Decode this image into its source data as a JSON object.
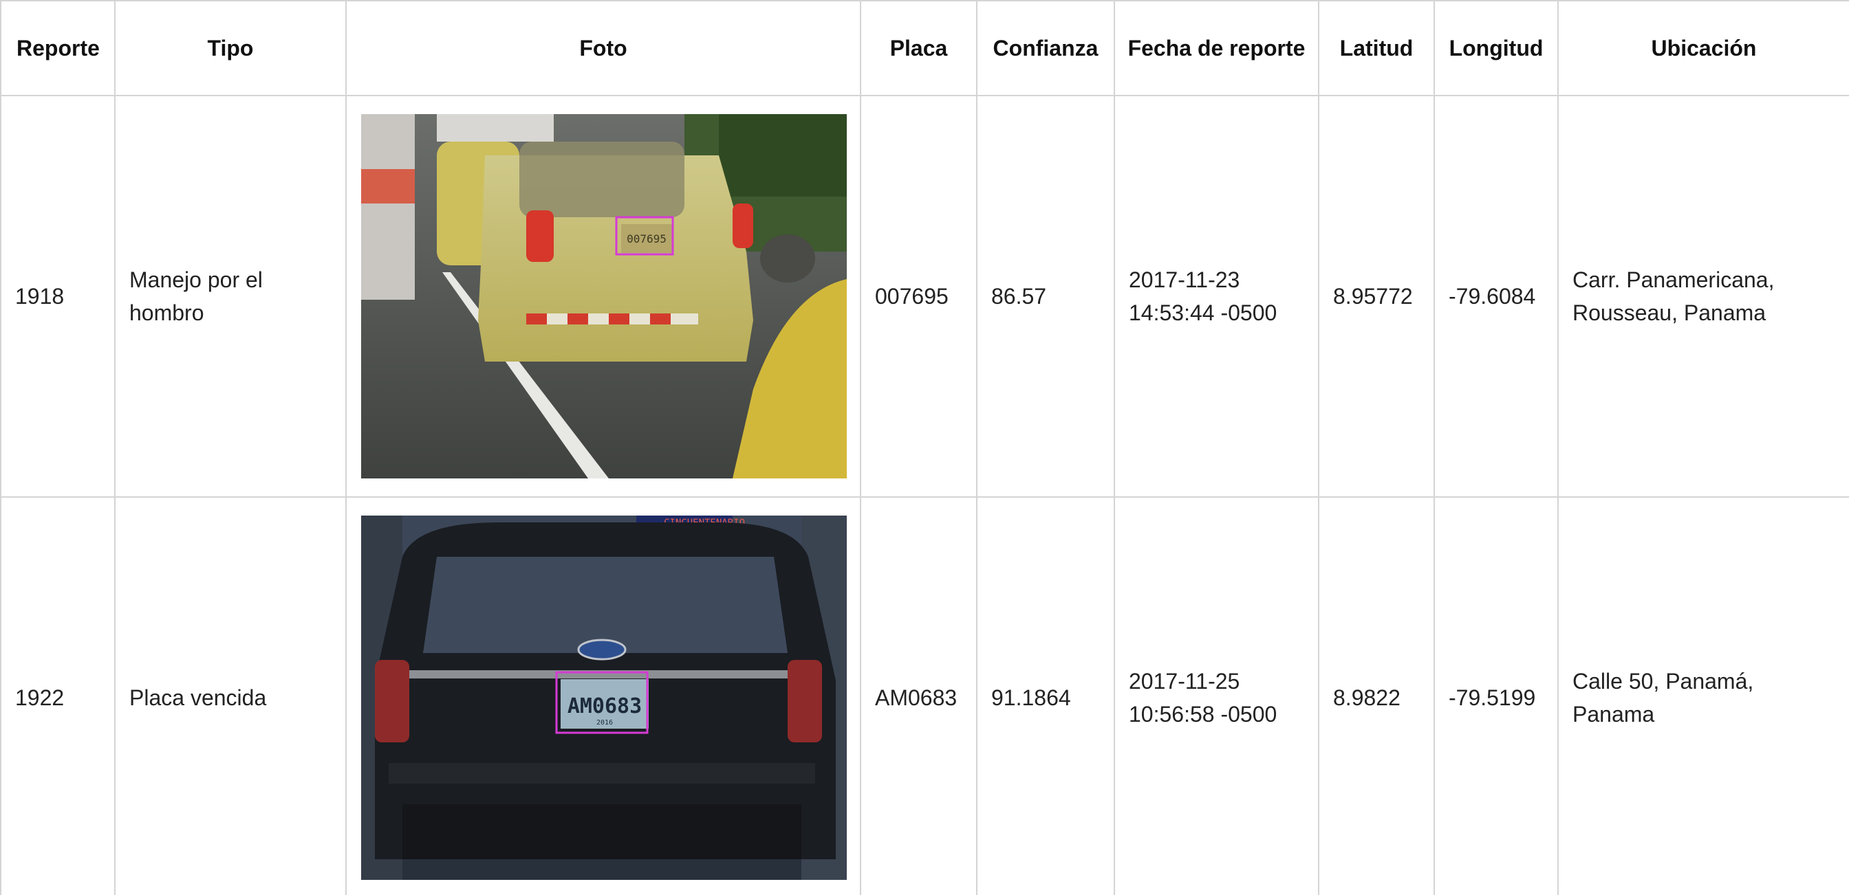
{
  "columns": {
    "reporte": "Reporte",
    "tipo": "Tipo",
    "foto": "Foto",
    "placa": "Placa",
    "confianza": "Confianza",
    "fecha": "Fecha de reporte",
    "latitud": "Latitud",
    "longitud": "Longitud",
    "ubicacion": "Ubicación"
  },
  "rows": [
    {
      "reporte": "1918",
      "tipo": "Manejo por el hombro",
      "photo_desc_icon": "rainy-traffic-taxi-photo",
      "photo_plate_text": "007695",
      "placa": "007695",
      "confianza": "86.57",
      "fecha": "2017-11-23 14:53:44 -0500",
      "latitud": "8.95772",
      "longitud": "-79.6084",
      "ubicacion": "Carr. Panamericana, Rousseau, Panama"
    },
    {
      "reporte": "1922",
      "tipo": "Placa vencida",
      "photo_desc_icon": "black-suv-rear-photo",
      "photo_plate_text": "AM0683",
      "photo_plate_year": "2016",
      "photo_sign_text": "CINCUENTENARIO",
      "placa": "AM0683",
      "confianza": "91.1864",
      "fecha": "2017-11-25 10:56:58 -0500",
      "latitud": "8.9822",
      "longitud": "-79.5199",
      "ubicacion": "Calle 50, Panamá, Panama"
    }
  ],
  "colors": {
    "border": "#d4d4d4",
    "detection_box": "#d53bd5",
    "taxi_yellow": "#d8cc6c"
  }
}
